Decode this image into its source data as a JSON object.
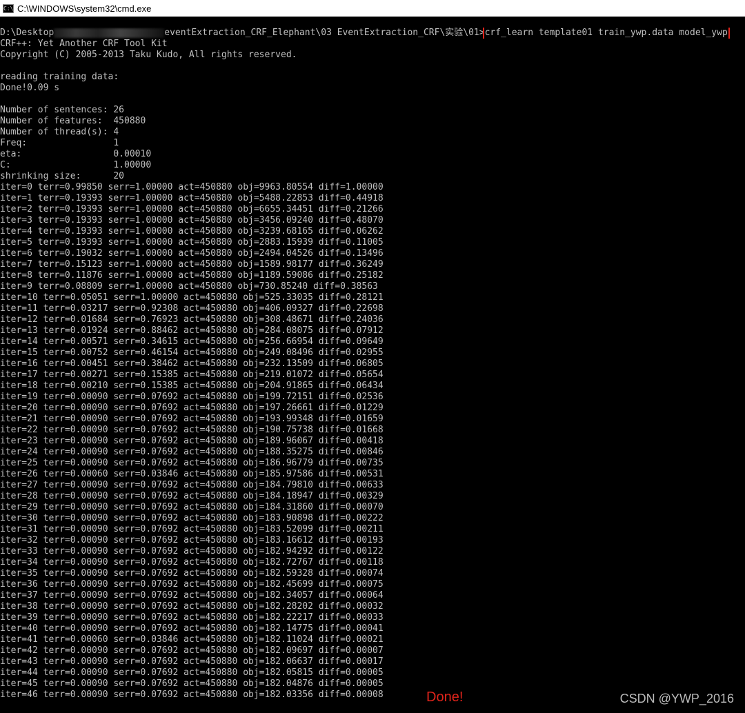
{
  "window": {
    "title": "C:\\WINDOWS\\system32\\cmd.exe",
    "icon_text": "C:\\"
  },
  "console": {
    "prompt_prefix": "D:\\Desktop",
    "prompt_suffix": "eventExtraction_CRF_Elephant\\03 EventExtraction_CRF\\实验\\01>",
    "command": "crf_learn template01 train_ywp.data model_ywp",
    "lines": [
      "CRF++: Yet Another CRF Tool Kit",
      "Copyright (C) 2005-2013 Taku Kudo, All rights reserved.",
      "",
      "reading training data:",
      "Done!0.09 s",
      "",
      "Number of sentences: 26",
      "Number of features:  450880",
      "Number of thread(s): 4",
      "Freq:                1",
      "eta:                 0.00010",
      "C:                   1.00000",
      "shrinking size:      20",
      "iter=0 terr=0.99850 serr=1.00000 act=450880 obj=9963.80554 diff=1.00000",
      "iter=1 terr=0.19393 serr=1.00000 act=450880 obj=5488.22853 diff=0.44918",
      "iter=2 terr=0.19393 serr=1.00000 act=450880 obj=6655.34451 diff=0.21266",
      "iter=3 terr=0.19393 serr=1.00000 act=450880 obj=3456.09240 diff=0.48070",
      "iter=4 terr=0.19393 serr=1.00000 act=450880 obj=3239.68165 diff=0.06262",
      "iter=5 terr=0.19393 serr=1.00000 act=450880 obj=2883.15939 diff=0.11005",
      "iter=6 terr=0.19032 serr=1.00000 act=450880 obj=2494.04526 diff=0.13496",
      "iter=7 terr=0.15123 serr=1.00000 act=450880 obj=1589.98177 diff=0.36249",
      "iter=8 terr=0.11876 serr=1.00000 act=450880 obj=1189.59086 diff=0.25182",
      "iter=9 terr=0.08809 serr=1.00000 act=450880 obj=730.85240 diff=0.38563",
      "iter=10 terr=0.05051 serr=1.00000 act=450880 obj=525.33035 diff=0.28121",
      "iter=11 terr=0.03217 serr=0.92308 act=450880 obj=406.09327 diff=0.22698",
      "iter=12 terr=0.01684 serr=0.76923 act=450880 obj=308.48671 diff=0.24036",
      "iter=13 terr=0.01924 serr=0.88462 act=450880 obj=284.08075 diff=0.07912",
      "iter=14 terr=0.00571 serr=0.34615 act=450880 obj=256.66954 diff=0.09649",
      "iter=15 terr=0.00752 serr=0.46154 act=450880 obj=249.08496 diff=0.02955",
      "iter=16 terr=0.00451 serr=0.38462 act=450880 obj=232.13509 diff=0.06805",
      "iter=17 terr=0.00271 serr=0.15385 act=450880 obj=219.01072 diff=0.05654",
      "iter=18 terr=0.00210 serr=0.15385 act=450880 obj=204.91865 diff=0.06434",
      "iter=19 terr=0.00090 serr=0.07692 act=450880 obj=199.72151 diff=0.02536",
      "iter=20 terr=0.00090 serr=0.07692 act=450880 obj=197.26661 diff=0.01229",
      "iter=21 terr=0.00090 serr=0.07692 act=450880 obj=193.99348 diff=0.01659",
      "iter=22 terr=0.00090 serr=0.07692 act=450880 obj=190.75738 diff=0.01668",
      "iter=23 terr=0.00090 serr=0.07692 act=450880 obj=189.96067 diff=0.00418",
      "iter=24 terr=0.00090 serr=0.07692 act=450880 obj=188.35275 diff=0.00846",
      "iter=25 terr=0.00090 serr=0.07692 act=450880 obj=186.96779 diff=0.00735",
      "iter=26 terr=0.00060 serr=0.03846 act=450880 obj=185.97586 diff=0.00531",
      "iter=27 terr=0.00090 serr=0.07692 act=450880 obj=184.79810 diff=0.00633",
      "iter=28 terr=0.00090 serr=0.07692 act=450880 obj=184.18947 diff=0.00329",
      "iter=29 terr=0.00090 serr=0.07692 act=450880 obj=184.31860 diff=0.00070",
      "iter=30 terr=0.00090 serr=0.07692 act=450880 obj=183.90898 diff=0.00222",
      "iter=31 terr=0.00090 serr=0.07692 act=450880 obj=183.52099 diff=0.00211",
      "iter=32 terr=0.00090 serr=0.07692 act=450880 obj=183.16612 diff=0.00193",
      "iter=33 terr=0.00090 serr=0.07692 act=450880 obj=182.94292 diff=0.00122",
      "iter=34 terr=0.00090 serr=0.07692 act=450880 obj=182.72767 diff=0.00118",
      "iter=35 terr=0.00090 serr=0.07692 act=450880 obj=182.59328 diff=0.00074",
      "iter=36 terr=0.00090 serr=0.07692 act=450880 obj=182.45699 diff=0.00075",
      "iter=37 terr=0.00090 serr=0.07692 act=450880 obj=182.34057 diff=0.00064",
      "iter=38 terr=0.00090 serr=0.07692 act=450880 obj=182.28202 diff=0.00032",
      "iter=39 terr=0.00090 serr=0.07692 act=450880 obj=182.22217 diff=0.00033",
      "iter=40 terr=0.00090 serr=0.07692 act=450880 obj=182.14775 diff=0.00041",
      "iter=41 terr=0.00060 serr=0.03846 act=450880 obj=182.11024 diff=0.00021",
      "iter=42 terr=0.00090 serr=0.07692 act=450880 obj=182.09697 diff=0.00007",
      "iter=43 terr=0.00090 serr=0.07692 act=450880 obj=182.06637 diff=0.00017",
      "iter=44 terr=0.00090 serr=0.07692 act=450880 obj=182.05815 diff=0.00005",
      "iter=45 terr=0.00090 serr=0.07692 act=450880 obj=182.04876 diff=0.00005",
      "iter=46 terr=0.00090 serr=0.07692 act=450880 obj=182.03356 diff=0.00008"
    ]
  },
  "annotation": {
    "done_text": "Done!",
    "color": "#e0241b"
  },
  "watermark": {
    "text": "CSDN @YWP_2016"
  }
}
